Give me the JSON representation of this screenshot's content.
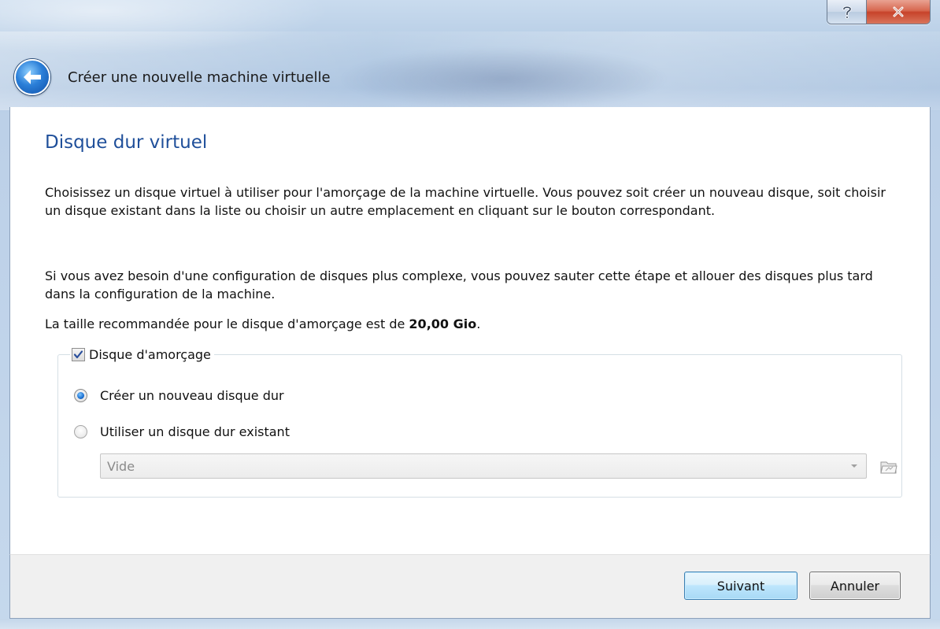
{
  "window": {
    "help_icon": "question-mark-icon",
    "close_icon": "close-x-icon"
  },
  "header": {
    "back_icon": "back-arrow-icon",
    "title": "Créer une nouvelle machine virtuelle"
  },
  "page": {
    "title": "Disque dur virtuel",
    "paragraph1": "Choisissez un disque virtuel à utiliser pour l'amorçage de la machine virtuelle. Vous pouvez soit créer un nouveau disque, soit choisir un disque existant dans la liste ou choisir un autre emplacement en cliquant sur le bouton correspondant.",
    "paragraph2": "Si vous avez besoin d'une configuration de disques plus complexe, vous pouvez sauter cette étape et allouer des disques plus tard dans la configuration de la machine.",
    "recommended_prefix": "La taille recommandée pour le disque d'amorçage est de ",
    "recommended_size": "20,00 Gio",
    "recommended_suffix": "."
  },
  "boot_disk": {
    "label": "Disque d'amorçage",
    "checked": true,
    "options": [
      {
        "label": "Créer un nouveau disque dur",
        "selected": true
      },
      {
        "label": "Utiliser un disque dur existant",
        "selected": false
      }
    ],
    "combo_value": "Vide",
    "folder_icon": "folder-browse-icon"
  },
  "footer": {
    "next_label": "Suivant",
    "cancel_label": "Annuler"
  },
  "colors": {
    "title_blue": "#1f4f9a",
    "default_button_border": "#3c7fb1"
  }
}
